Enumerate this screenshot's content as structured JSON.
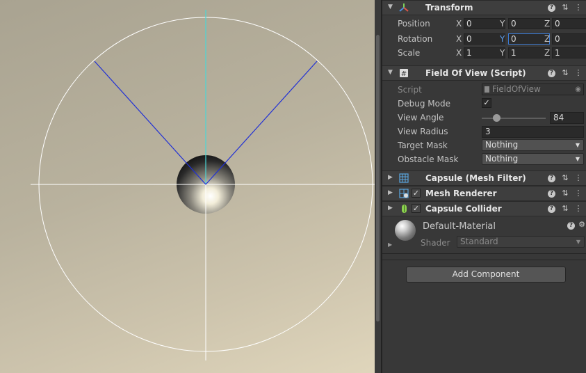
{
  "scene": {
    "gizmo_colors": {
      "fov_lines": "#1f2fd6",
      "y_axis": "#4ad6d6",
      "circle": "#ffffff",
      "cross": "#ffffff"
    }
  },
  "inspector": {
    "transform": {
      "title": "Transform",
      "icon": "transform-icon",
      "rows": [
        {
          "label": "Position",
          "x": "0",
          "y": "0",
          "z": "0"
        },
        {
          "label": "Rotation",
          "x": "0",
          "y": "0",
          "z": "0"
        },
        {
          "label": "Scale",
          "x": "1",
          "y": "1",
          "z": "1"
        }
      ],
      "axes": {
        "x": "X",
        "y": "Y",
        "z": "Z"
      }
    },
    "fov": {
      "title": "Field Of View (Script)",
      "icon": "script-icon",
      "script_label": "Script",
      "script_value": "FieldOfView",
      "debug_label": "Debug Mode",
      "debug_checked": true,
      "angle_label": "View Angle",
      "angle_value": "84",
      "angle_fraction": 0.23,
      "radius_label": "View Radius",
      "radius_value": "3",
      "target_label": "Target Mask",
      "target_value": "Nothing",
      "obstacle_label": "Obstacle Mask",
      "obstacle_value": "Nothing"
    },
    "mesh_filter": {
      "title": "Capsule (Mesh Filter)",
      "icon": "mesh-filter-icon"
    },
    "mesh_renderer": {
      "title": "Mesh Renderer",
      "icon": "mesh-renderer-icon",
      "enabled": true
    },
    "capsule_collider": {
      "title": "Capsule Collider",
      "icon": "capsule-collider-icon",
      "enabled": true
    },
    "material": {
      "name": "Default-Material",
      "shader_label": "Shader",
      "shader_value": "Standard"
    },
    "add_component": "Add Component"
  }
}
